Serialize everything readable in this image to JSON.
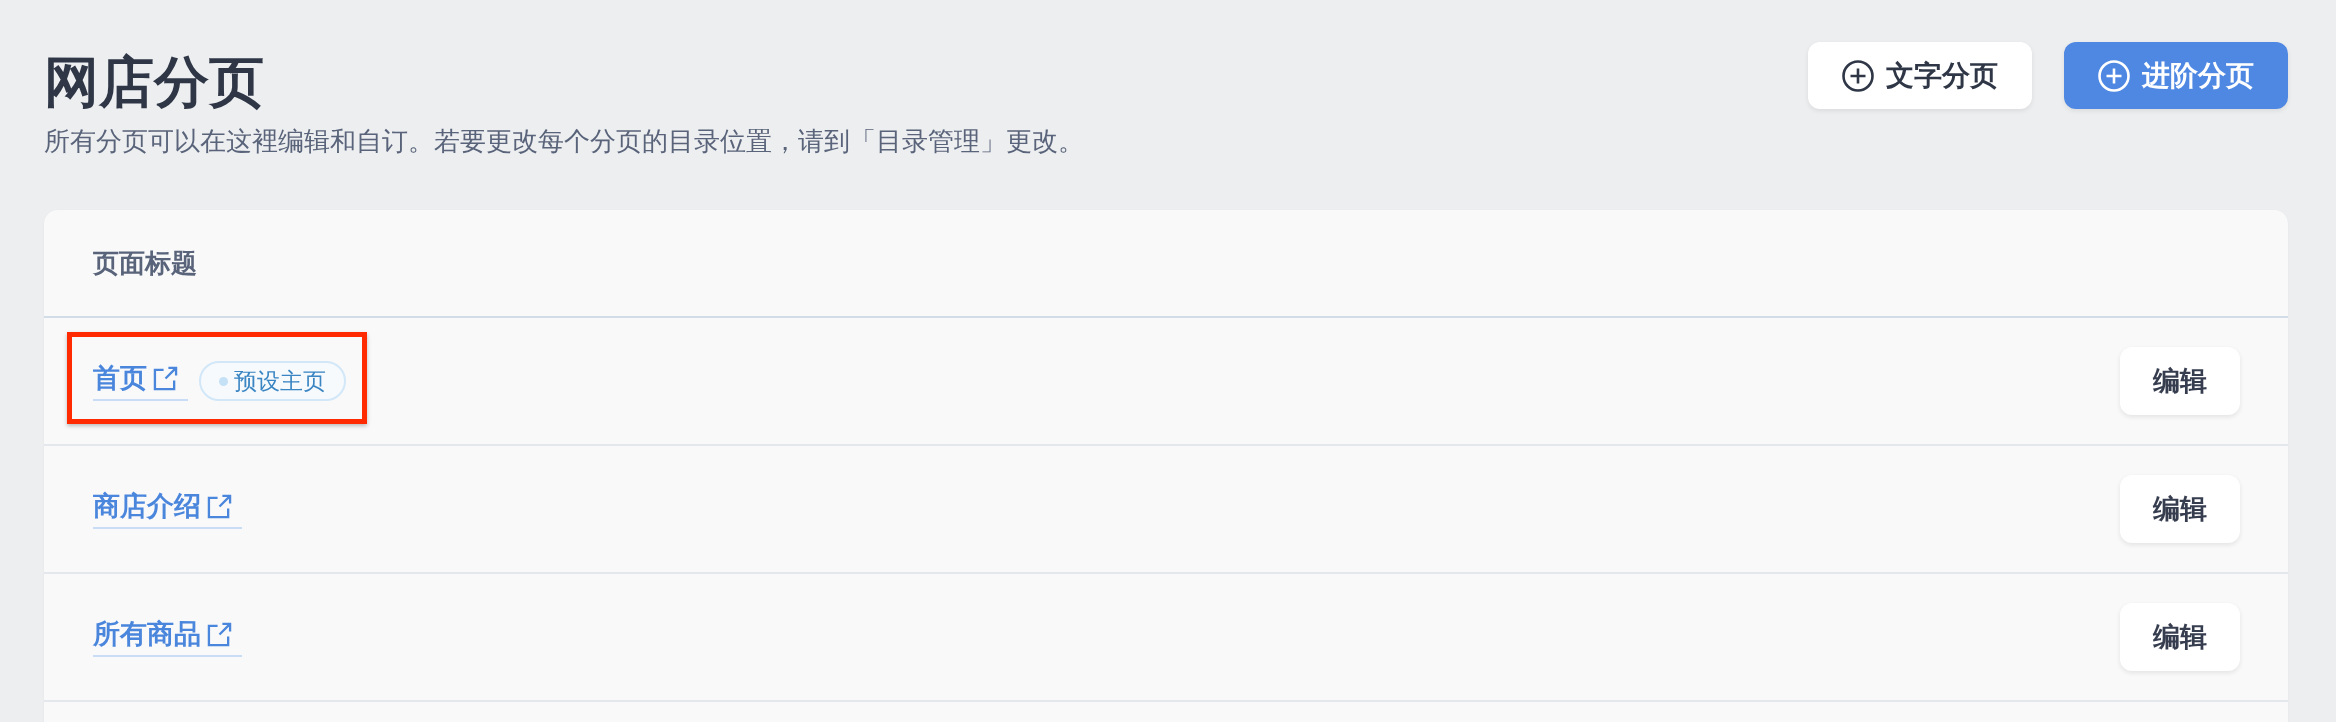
{
  "page": {
    "title": "网店分页",
    "description": "所有分页可以在这裡编辑和自订。若要更改每个分页的目录位置，请到「目录管理」更改。"
  },
  "actions": [
    {
      "label": "文字分页",
      "kind": "secondary"
    },
    {
      "label": "进阶分页",
      "kind": "primary"
    }
  ],
  "table": {
    "columns": [
      "页面标题"
    ],
    "rows": [
      {
        "title": "首页",
        "tag": "预设主页",
        "highlighted": true,
        "action": "编辑"
      },
      {
        "title": "商店介绍",
        "highlighted": false,
        "action": "编辑"
      },
      {
        "title": "所有商品",
        "highlighted": false,
        "action": "编辑"
      }
    ]
  }
}
